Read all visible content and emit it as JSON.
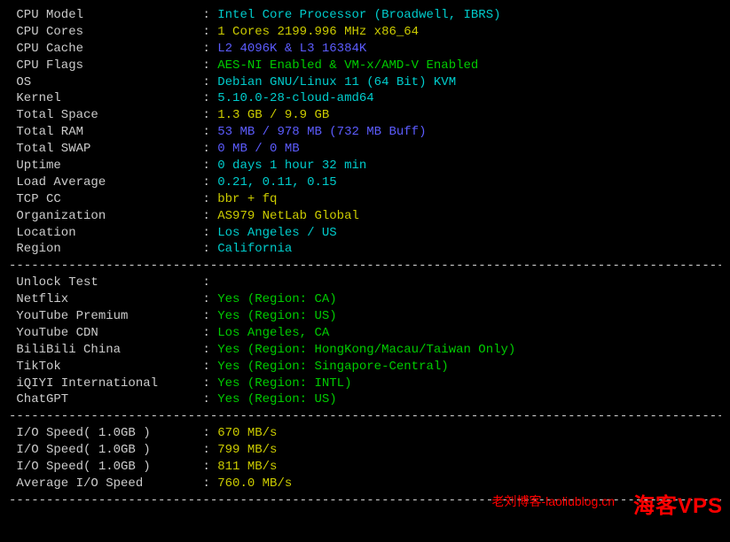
{
  "system": {
    "cpu_model": {
      "label": "CPU Model",
      "value": "Intel Core Processor (Broadwell, IBRS)",
      "color": "cyan"
    },
    "cpu_cores": {
      "label": "CPU Cores",
      "value": "1 Cores 2199.996 MHz x86_64",
      "color": "yellow"
    },
    "cpu_cache": {
      "label": "CPU Cache",
      "value": "L2 4096K & L3 16384K",
      "color": "blue"
    },
    "cpu_flags": {
      "label": "CPU Flags",
      "value": "AES-NI Enabled & VM-x/AMD-V Enabled",
      "color": "green"
    },
    "os": {
      "label": "OS",
      "value": "Debian GNU/Linux 11 (64 Bit) KVM",
      "color": "cyan"
    },
    "kernel": {
      "label": "Kernel",
      "value": "5.10.0-28-cloud-amd64",
      "color": "cyan"
    },
    "space": {
      "label": "Total Space",
      "value": "1.3 GB / 9.9 GB",
      "color": "yellow"
    },
    "ram": {
      "label": "Total RAM",
      "value": "53 MB / 978 MB (732 MB Buff)",
      "color": "blue"
    },
    "swap": {
      "label": "Total SWAP",
      "value": "0 MB / 0 MB",
      "color": "blue"
    },
    "uptime": {
      "label": "Uptime",
      "value": "0 days 1 hour 32 min",
      "color": "cyan"
    },
    "load": {
      "label": "Load Average",
      "value": "0.21, 0.11, 0.15",
      "color": "cyan"
    },
    "tcp": {
      "label": "TCP CC",
      "value": "bbr + fq",
      "color": "yellow"
    },
    "org": {
      "label": "Organization",
      "value": "AS979 NetLab Global",
      "color": "yellow"
    },
    "loc": {
      "label": "Location",
      "value": "Los Angeles / US",
      "color": "cyan"
    },
    "region": {
      "label": "Region",
      "value": "California",
      "color": "cyan"
    }
  },
  "unlock_header": "Unlock Test",
  "unlock": {
    "netflix": {
      "label": "Netflix",
      "value": "Yes (Region: CA)",
      "color": "green"
    },
    "ytprem": {
      "label": "YouTube Premium",
      "value": "Yes (Region: US)",
      "color": "green"
    },
    "ytcdn": {
      "label": "YouTube CDN",
      "value": "Los Angeles, CA",
      "color": "green"
    },
    "bili": {
      "label": "BiliBili China",
      "value": "Yes (Region: HongKong/Macau/Taiwan Only)",
      "color": "green"
    },
    "tiktok": {
      "label": "TikTok",
      "value": "Yes (Region: Singapore-Central)",
      "color": "green"
    },
    "iqiyi": {
      "label": "iQIYI International",
      "value": "Yes (Region: INTL)",
      "color": "green"
    },
    "chatgpt": {
      "label": "ChatGPT",
      "value": "Yes (Region: US)",
      "color": "green"
    }
  },
  "io": {
    "t1": {
      "label": "I/O Speed( 1.0GB )",
      "value": "670 MB/s",
      "color": "yellow"
    },
    "t2": {
      "label": "I/O Speed( 1.0GB )",
      "value": "799 MB/s",
      "color": "yellow"
    },
    "t3": {
      "label": "I/O Speed( 1.0GB )",
      "value": "811 MB/s",
      "color": "yellow"
    },
    "avg": {
      "label": "Average I/O Speed",
      "value": "760.0 MB/s",
      "color": "yellow"
    }
  },
  "divider": "----------------------------------------------------------------------------------------------------",
  "watermark1": "老刘博客-laoliublog.cn",
  "watermark2": "海客VPS"
}
